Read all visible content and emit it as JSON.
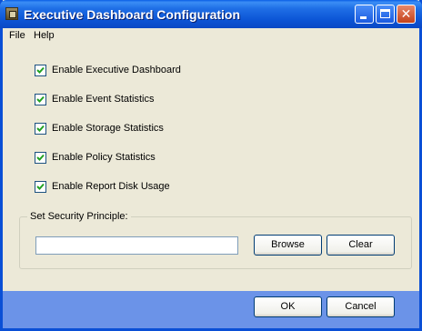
{
  "window": {
    "title": "Executive Dashboard Configuration"
  },
  "menu": {
    "file": "File",
    "help": "Help"
  },
  "options": [
    {
      "label": "Enable Executive Dashboard",
      "checked": true
    },
    {
      "label": "Enable Event Statistics",
      "checked": true
    },
    {
      "label": "Enable Storage Statistics",
      "checked": true
    },
    {
      "label": "Enable Policy Statistics",
      "checked": true
    },
    {
      "label": "Enable Report Disk Usage",
      "checked": true
    }
  ],
  "security": {
    "group_label": "Set Security Principle:",
    "value": "",
    "browse_label": "Browse",
    "clear_label": "Clear"
  },
  "footer": {
    "ok_label": "OK",
    "cancel_label": "Cancel"
  },
  "colors": {
    "titlebar": "#0c55d6",
    "footer": "#6b93e8",
    "dialog_bg": "#ece9d8"
  }
}
